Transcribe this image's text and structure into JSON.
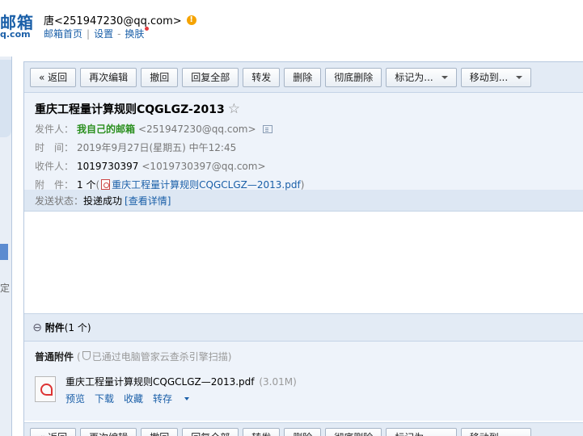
{
  "header": {
    "logo_main": "邮箱",
    "logo_sub": "q.com",
    "user_line": "唐<251947230@qq.com>",
    "links": [
      "邮箱首页",
      "设置",
      "换肤"
    ],
    "link_sep": "|",
    "link_dash": "-"
  },
  "sidebar": {
    "fragment_text": "定"
  },
  "toolbar": {
    "back": "« 返回",
    "reedit": "再次编辑",
    "recall": "撤回",
    "reply_all": "回复全部",
    "forward": "转发",
    "delete": "删除",
    "delete_forever": "彻底删除",
    "mark_as": "标记为...",
    "move_to": "移动到..."
  },
  "mail": {
    "subject": "重庆工程量计算规则CQGLGZ-2013",
    "star": "☆",
    "sender_label": "发件人：",
    "sender_name": "我自己的邮箱",
    "sender_addr": "<251947230@qq.com>",
    "time_label": "时　间：",
    "time_value": "2019年9月27日(星期五) 中午12:45",
    "recipient_label": "收件人：",
    "recipient_name": "1019730397",
    "recipient_addr": "<1019730397@qq.com>",
    "attach_label": "附　件：",
    "attach_count": "1 个",
    "attach_paren_open": "(",
    "attach_file": "重庆工程量计算规则CQGCLGZ—2013.pdf",
    "attach_paren_close": ")",
    "status_label": "发送状态：",
    "status_value": "投递成功",
    "status_link": "[查看详情]"
  },
  "attachments": {
    "title": "附件",
    "count": "(1 个)",
    "section_label": "普通附件",
    "scan_open": "(",
    "scan_text": "已通过电脑管家云查杀引擎扫描)",
    "file_name": "重庆工程量计算规则CQGCLGZ—2013.pdf",
    "file_size": "(3.01M)",
    "actions": {
      "preview": "预览",
      "download": "下载",
      "favorite": "收藏",
      "save_to": "转存"
    }
  },
  "colors": {
    "accent": "#1a5fa8",
    "sender_green": "#2a8f1e",
    "toolbar_bg": "#e3ebf5",
    "info_bg": "#eef3fa"
  }
}
